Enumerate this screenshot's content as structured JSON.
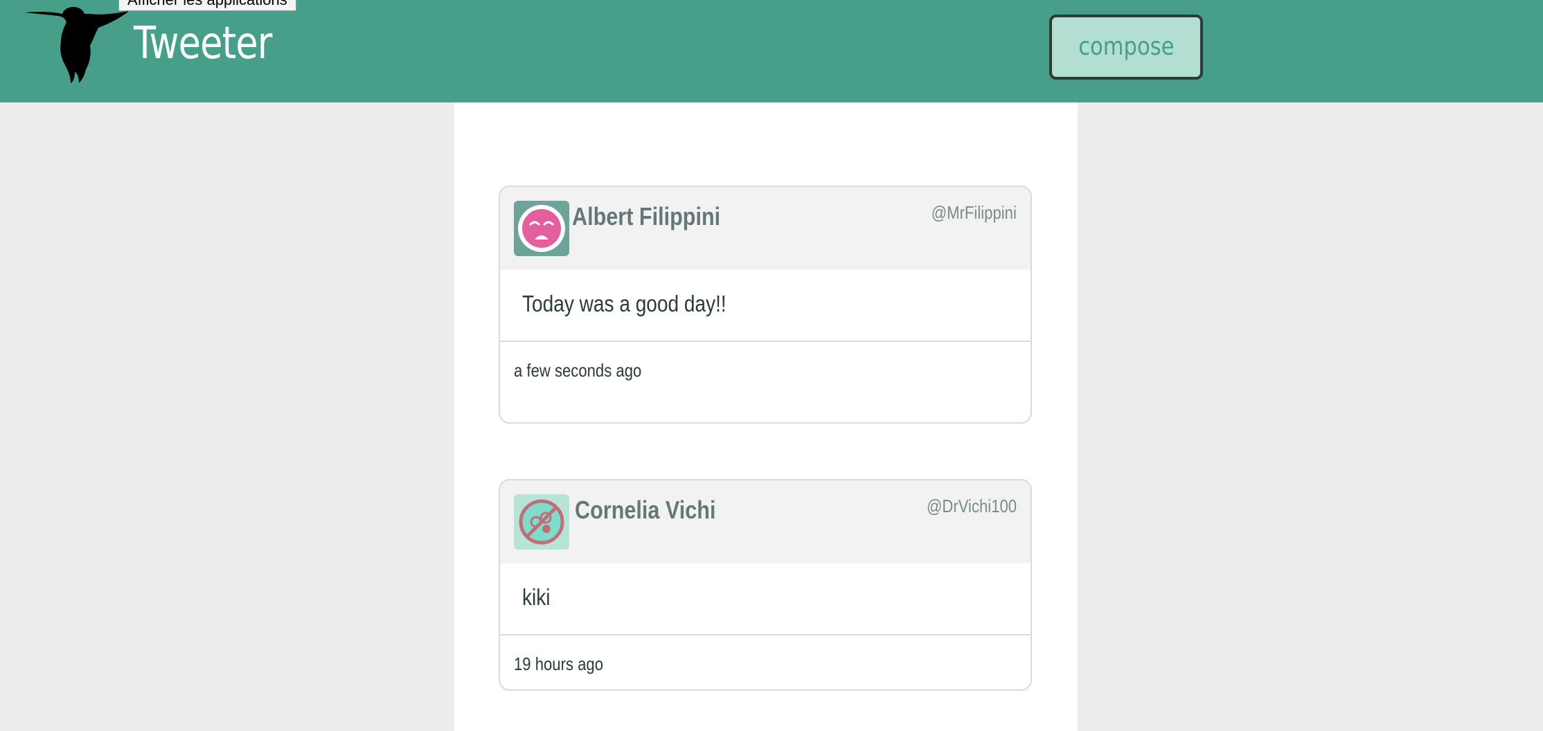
{
  "header": {
    "brand": "Tweeter",
    "compose_label": "compose",
    "tooltip": "Afficher les applications"
  },
  "colors": {
    "accent": "#479f8a",
    "compose_bg": "#b2dfd2",
    "page_bg": "#ececec"
  },
  "icons": {
    "logo": "hummingbird-icon"
  },
  "tweets": [
    {
      "name": "Albert Filippini",
      "handle": "@MrFilippini",
      "text": "Today was a good day!!",
      "time": "a few seconds ago",
      "avatar": "sad-face-avatar"
    },
    {
      "name": "Cornelia Vichi",
      "handle": "@DrVichi100",
      "text": "kiki",
      "time": "19 hours ago",
      "avatar": "no-pills-avatar"
    }
  ]
}
